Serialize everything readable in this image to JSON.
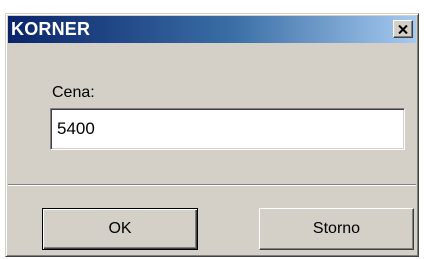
{
  "window": {
    "title": "KORNER"
  },
  "title_bar": {
    "close_icon": "close-icon"
  },
  "form": {
    "price_label": "Cena:",
    "price_value": "5400"
  },
  "buttons": {
    "ok_label": "OK",
    "cancel_label": "Storno"
  },
  "colors": {
    "title_gradient_start": "#0a246a",
    "title_gradient_end": "#a6caf0",
    "dialog_face": "#d4d0c8"
  }
}
